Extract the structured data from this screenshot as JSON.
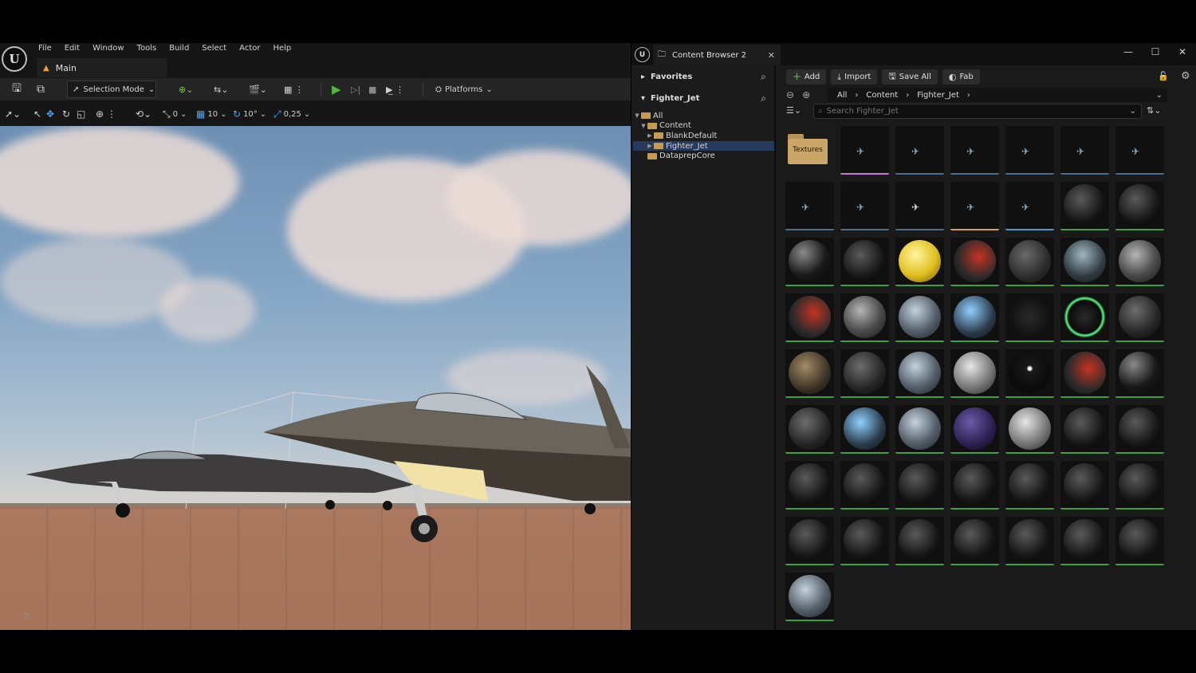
{
  "editor": {
    "menu": [
      "File",
      "Edit",
      "Window",
      "Tools",
      "Build",
      "Select",
      "Actor",
      "Help"
    ],
    "level_tab": "Main",
    "selection_mode": "Selection Mode",
    "platforms": "Platforms",
    "snap": {
      "translate": "0",
      "grid": "10",
      "rotate": "10°",
      "scale": "0,25"
    }
  },
  "content_browser": {
    "tab_title": "Content Browser 2",
    "favorites": "Favorites",
    "root_folder": "Fighter_Jet",
    "tree": [
      {
        "label": "All",
        "depth": 0
      },
      {
        "label": "Content",
        "depth": 1
      },
      {
        "label": "BlankDefault",
        "depth": 2
      },
      {
        "label": "Fighter_Jet",
        "depth": 2,
        "selected": true
      },
      {
        "label": "DataprepCore",
        "depth": 1
      }
    ],
    "actions": {
      "add": "Add",
      "import": "Import",
      "save_all": "Save All",
      "fab": "Fab"
    },
    "breadcrumb": [
      "All",
      "Content",
      "Fighter_Jet"
    ],
    "search_placeholder": "Search Fighter_Jet",
    "folder_tile": "Textures"
  },
  "colors": {
    "accent_green": "#4fb83d",
    "asset_bar_material": "#3fa04a",
    "asset_bar_mesh": "#4d6e8a",
    "selection_blue": "#253a5c"
  }
}
